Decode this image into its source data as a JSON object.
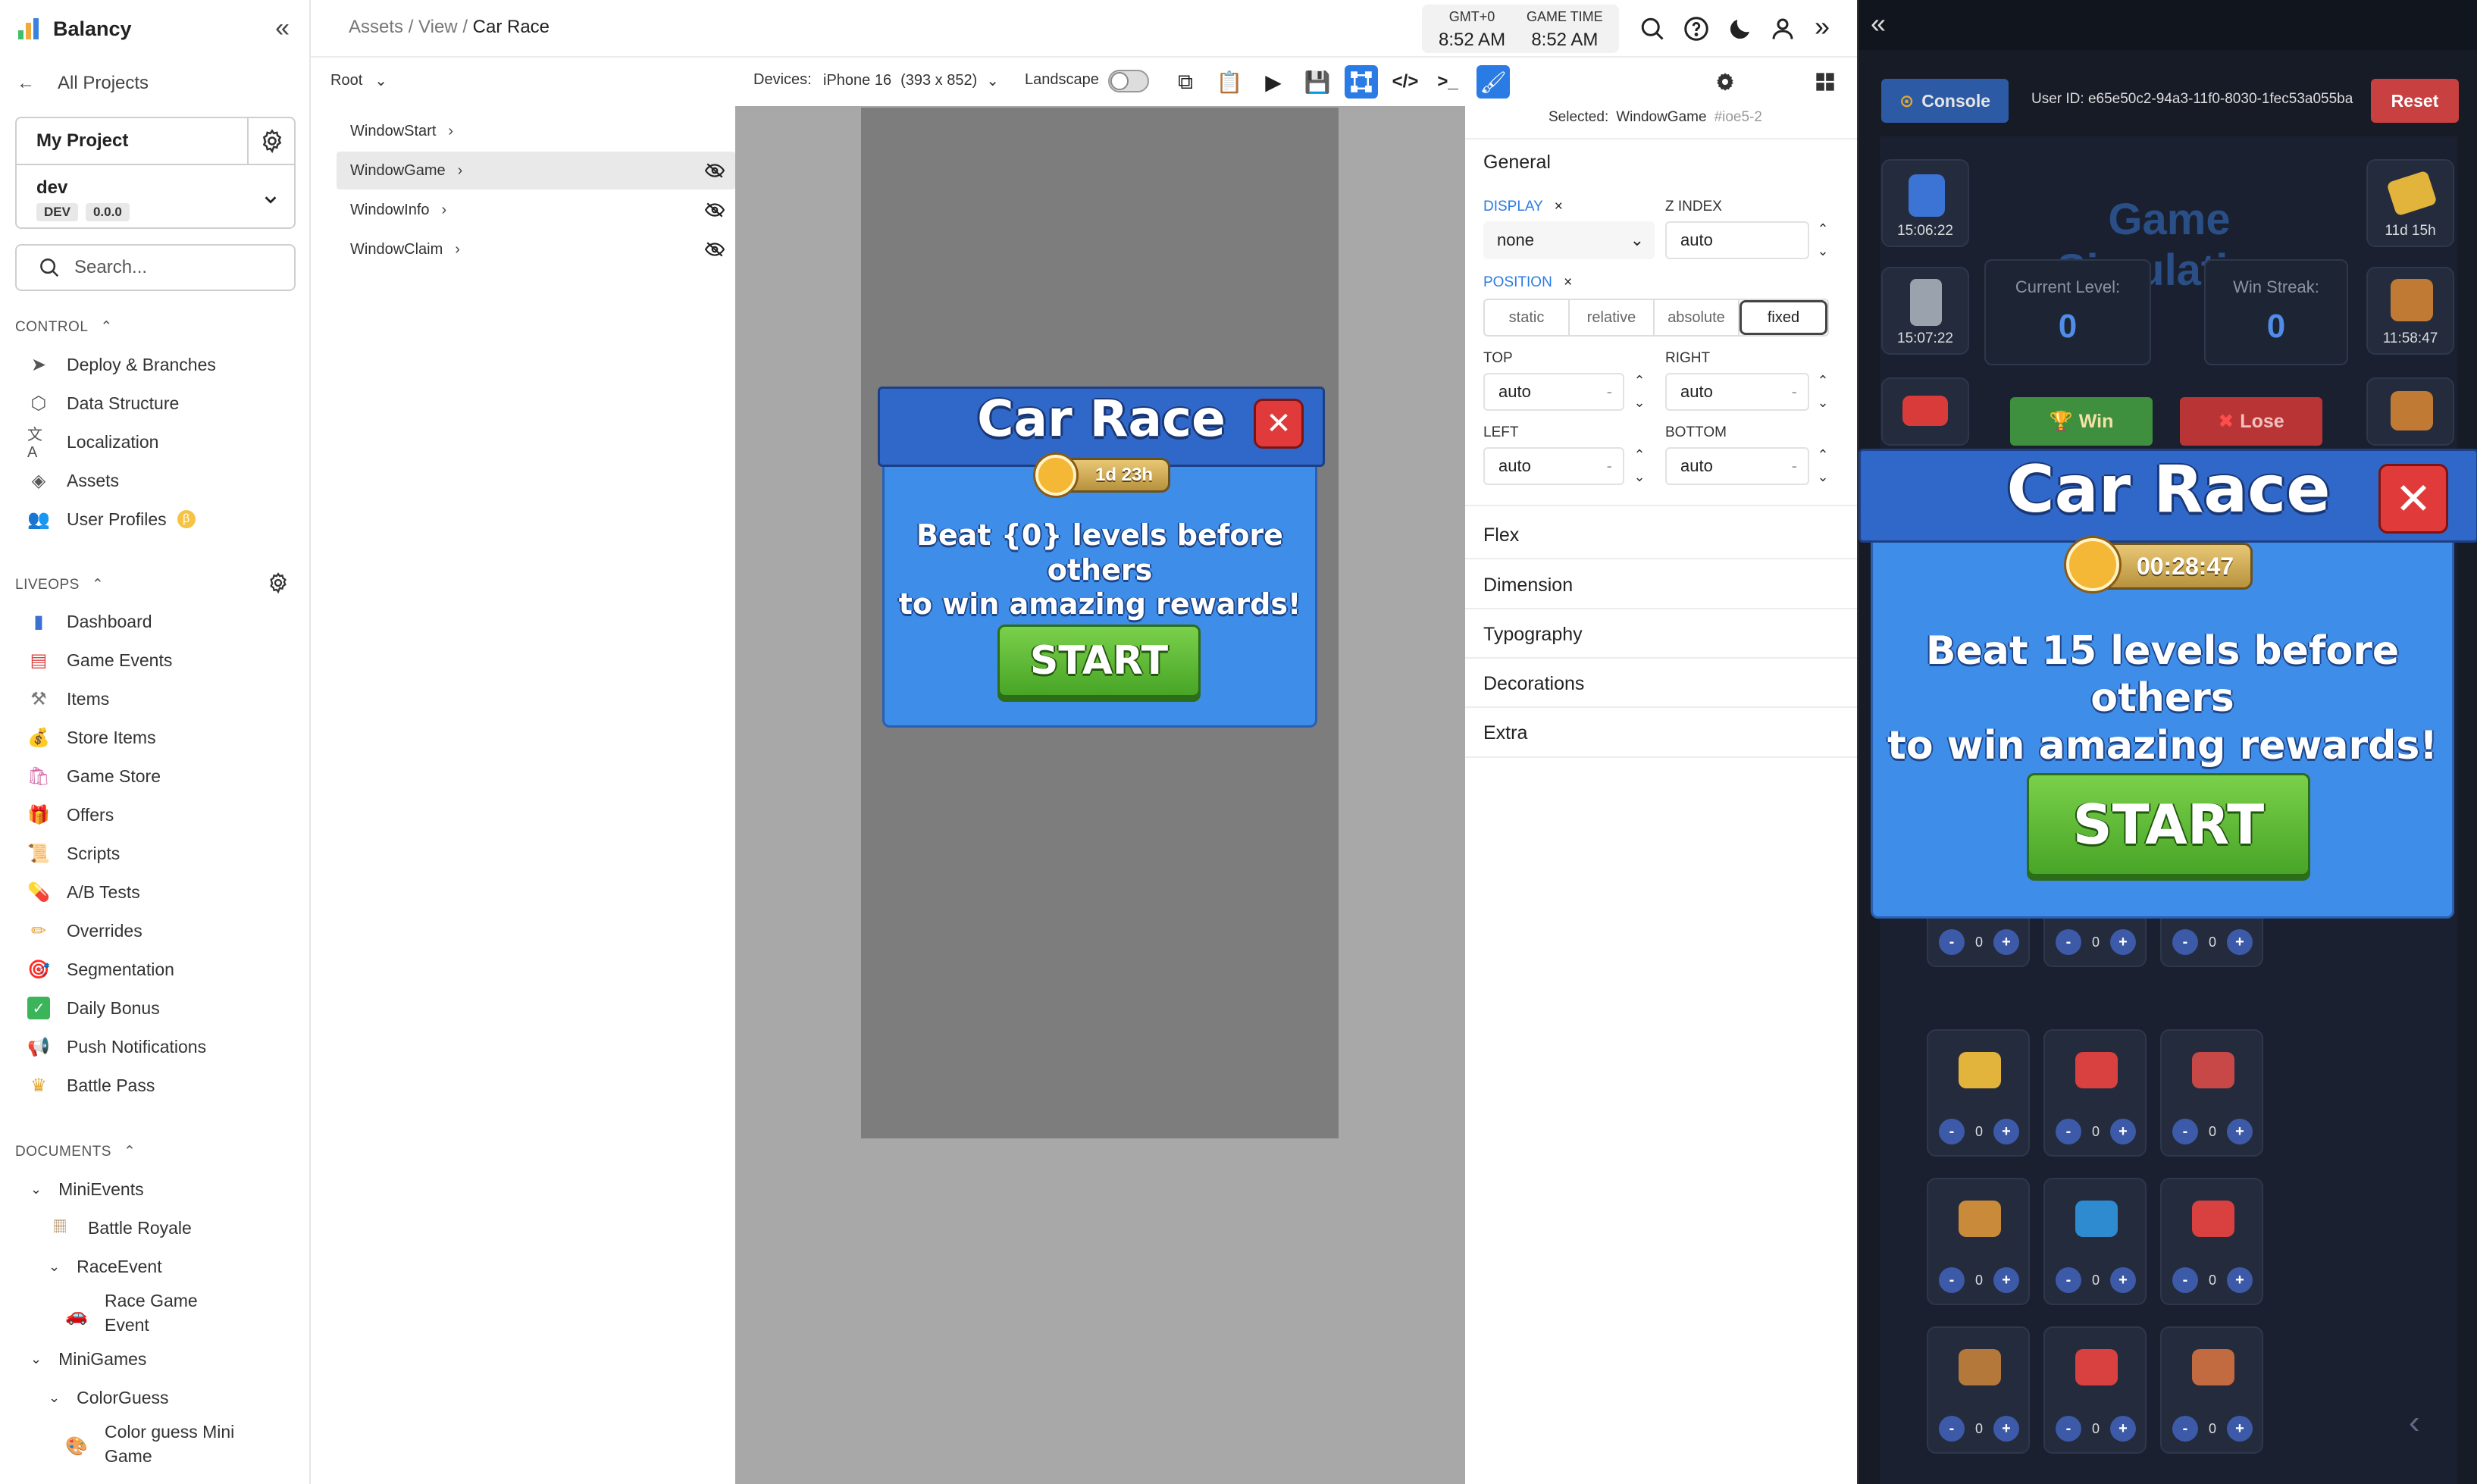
{
  "brand": {
    "name": "Balancy"
  },
  "nav": {
    "all_projects": "All Projects",
    "project_name": "My Project",
    "env_name": "dev",
    "env_badge": "DEV",
    "env_version": "0.0.0",
    "search_placeholder": "Search...",
    "control_title": "CONTROL",
    "control_items": [
      {
        "label": "Deploy & Branches",
        "icon": "paper-plane-icon"
      },
      {
        "label": "Data Structure",
        "icon": "cube-icon"
      },
      {
        "label": "Localization",
        "icon": "translate-icon"
      },
      {
        "label": "Assets",
        "icon": "shapes-icon"
      },
      {
        "label": "User Profiles",
        "icon": "users-icon",
        "badge": "β"
      }
    ],
    "liveops_title": "LIVEOPS",
    "liveops_items": [
      {
        "label": "Dashboard",
        "icon": "bar-chart-icon"
      },
      {
        "label": "Game Events",
        "icon": "calendar-icon"
      },
      {
        "label": "Items",
        "icon": "hammer-icon"
      },
      {
        "label": "Store Items",
        "icon": "money-bag-icon"
      },
      {
        "label": "Game Store",
        "icon": "shopping-bags-icon"
      },
      {
        "label": "Offers",
        "icon": "gift-icon"
      },
      {
        "label": "Scripts",
        "icon": "scroll-icon"
      },
      {
        "label": "A/B Tests",
        "icon": "pill-icon"
      },
      {
        "label": "Overrides",
        "icon": "pencil-icon"
      },
      {
        "label": "Segmentation",
        "icon": "target-icon"
      },
      {
        "label": "Daily Bonus",
        "icon": "check-icon"
      },
      {
        "label": "Push Notifications",
        "icon": "megaphone-icon"
      },
      {
        "label": "Battle Pass",
        "icon": "crown-icon"
      }
    ],
    "documents_title": "DOCUMENTS",
    "documents": {
      "minievents": "MiniEvents",
      "battle_royale": "Battle Royale",
      "race_event": "RaceEvent",
      "race_game_event_1": "Race Game",
      "race_game_event_2": "Event",
      "minigames": "MiniGames",
      "colorguess": "ColorGuess",
      "color_guess_1": "Color guess Mini",
      "color_guess_2": "Game"
    }
  },
  "topbar": {
    "crumb_1": "Assets",
    "crumb_2": "View",
    "crumb_3": "Car Race",
    "sep": "/",
    "tz_label": "GMT+0",
    "tz_time": "8:52 AM",
    "game_label": "GAME TIME",
    "game_time": "8:52 AM"
  },
  "toolbar": {
    "root": "Root",
    "devices_label": "Devices:",
    "device": "iPhone 16",
    "device_size": "(393 x 852)",
    "landscape": "Landscape"
  },
  "tree": [
    {
      "label": "WindowStart",
      "hidden": false
    },
    {
      "label": "WindowGame",
      "hidden": true,
      "selected": true
    },
    {
      "label": "WindowInfo",
      "hidden": true
    },
    {
      "label": "WindowClaim",
      "hidden": true
    }
  ],
  "preview": {
    "title": "Car Race",
    "timer": "1d 23h",
    "message_1": "Beat {0} levels before others",
    "message_2": "to win amazing rewards!",
    "start": "START"
  },
  "props": {
    "selected_label": "Selected:",
    "selected_name": "WindowGame",
    "selected_id": "#ioe5-2",
    "general": "General",
    "display_label": "DISPLAY",
    "display_value": "none",
    "zindex_label": "Z INDEX",
    "zindex_value": "auto",
    "position_label": "POSITION",
    "position_options": [
      "static",
      "relative",
      "absolute",
      "fixed"
    ],
    "position_selected": "fixed",
    "top_label": "TOP",
    "top_value": "auto",
    "right_label": "RIGHT",
    "right_value": "auto",
    "left_label": "LEFT",
    "left_value": "auto",
    "bottom_label": "BOTTOM",
    "bottom_value": "auto",
    "unit_dash": "-",
    "x_mark": "×",
    "sections": [
      "Flex",
      "Dimension",
      "Typography",
      "Decorations",
      "Extra"
    ]
  },
  "sim": {
    "console": "Console",
    "user_id": "User ID: e65e50c2-94a3-11f0-8030-1fec53a055ba",
    "reset": "Reset",
    "heading": "Game Simulation",
    "timer_1": "15:06:22",
    "timer_2": "15:07:22",
    "timer_3": "11d 15h",
    "timer_4": "11:58:47",
    "current_level_label": "Current Level:",
    "current_level": "0",
    "win_streak_label": "Win Streak:",
    "win_streak": "0",
    "win": "Win",
    "lose": "Lose",
    "popup_title": "Car Race",
    "popup_timer": "00:28:47",
    "popup_msg_1": "Beat 15 levels before others",
    "popup_msg_2": "to win amazing rewards!",
    "popup_start": "START",
    "counter_minus": "-",
    "counter_plus": "+",
    "counter_value": "0"
  },
  "colors": {
    "accent": "#2b7be4",
    "popup_blue": "#3d8de9",
    "start_green": "#5cb934",
    "close_red": "#e03a3a",
    "sim_bg": "#11151d"
  }
}
